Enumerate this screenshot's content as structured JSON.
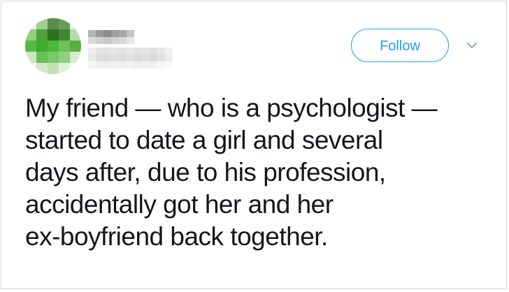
{
  "tweet": {
    "follow_label": "Follow",
    "chevron_icon": "chevron-down-icon",
    "text_lines": [
      "My friend — who is a psychologist —",
      "started to date a girl and several",
      "days after, due to his profession,",
      "accidentally got her and her",
      "ex-boyfriend back together."
    ]
  },
  "colors": {
    "accent": "#1da1f2",
    "text": "#14171a",
    "border": "#d6d6d6"
  }
}
